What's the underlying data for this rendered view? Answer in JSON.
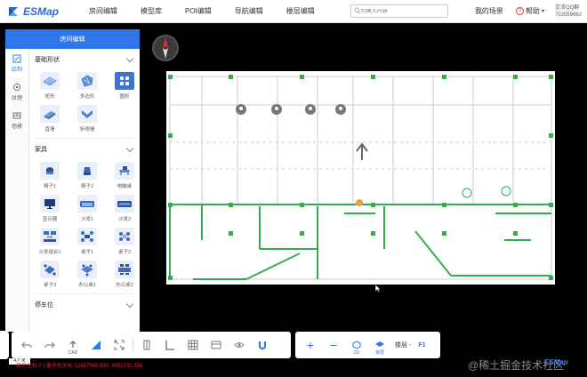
{
  "app": {
    "name": "ESMap",
    "brand_color": "#2b68d8"
  },
  "nav": {
    "items": [
      {
        "label": "房间编辑",
        "active": true
      },
      {
        "label": "模型库"
      },
      {
        "label": "POI编辑"
      },
      {
        "label": "导航编辑"
      },
      {
        "label": "楼层编辑"
      }
    ]
  },
  "search": {
    "placeholder": "切换入内容"
  },
  "topright": {
    "my_scenes": "我的场景",
    "help": "帮助",
    "contact_line1": "交流QQ群",
    "contact_line2": "702059662"
  },
  "panel": {
    "title": "房间编辑",
    "tabs": [
      {
        "label": "绘制",
        "icon": "draw-icon",
        "active": true
      },
      {
        "label": "纹理",
        "icon": "texture-icon"
      },
      {
        "label": "墙模",
        "icon": "wall-icon"
      }
    ],
    "sections": [
      {
        "title": "基础形状",
        "items": [
          {
            "label": "矩形",
            "icon": "rectangle-shape-icon"
          },
          {
            "label": "多边形",
            "icon": "polygon-shape-icon"
          },
          {
            "label": "圆形",
            "icon": "circle-shape-icon"
          },
          {
            "label": "直墙",
            "icon": "straight-wall-icon"
          },
          {
            "label": "折线墙",
            "icon": "polyline-wall-icon"
          }
        ]
      },
      {
        "title": "家具",
        "items": [
          {
            "label": "椅子1",
            "icon": "chair-icon"
          },
          {
            "label": "椅子2",
            "icon": "chair-icon"
          },
          {
            "label": "电脑桌",
            "icon": "computer-desk-icon"
          },
          {
            "label": "显示器",
            "icon": "monitor-icon"
          },
          {
            "label": "沙发1",
            "icon": "sofa-icon"
          },
          {
            "label": "沙发2",
            "icon": "sofa-icon"
          },
          {
            "label": "沙发组合1",
            "icon": "sofa-set-icon"
          },
          {
            "label": "桌子1",
            "icon": "table-icon"
          },
          {
            "label": "桌子2",
            "icon": "table-icon"
          },
          {
            "label": "桌子3",
            "icon": "table-icon"
          },
          {
            "label": "办公桌1",
            "icon": "office-desk-icon"
          },
          {
            "label": "办公桌2",
            "icon": "office-desk-icon"
          }
        ]
      },
      {
        "title": "停车位"
      }
    ]
  },
  "toolbar": {
    "buttons": [
      {
        "name": "undo-button",
        "icon": "undo-icon"
      },
      {
        "name": "redo-button",
        "icon": "redo-icon"
      },
      {
        "name": "cad-import-button",
        "icon": "upload-icon",
        "label": "CAD"
      },
      {
        "name": "draw-triangle-button",
        "icon": "triangle-icon"
      },
      {
        "name": "fullscreen-button",
        "icon": "expand-icon"
      },
      {
        "name": "align-button",
        "icon": "align-icon"
      },
      {
        "name": "angle-button",
        "icon": "angle-icon"
      },
      {
        "name": "grid-button",
        "icon": "grid-icon"
      },
      {
        "name": "layer-button",
        "icon": "layer-icon"
      },
      {
        "name": "visibility-button",
        "icon": "eye-icon"
      },
      {
        "name": "magnet-button",
        "icon": "magnet-icon"
      }
    ]
  },
  "view_toolbar": {
    "zoom_in": "+",
    "zoom_out": "−",
    "mode_2d": "2D",
    "mode_single": "单层",
    "floor_label": "楼层",
    "floor_value": "F1"
  },
  "footer": {
    "scale": "4.7 米",
    "coords": "显示坐标:0 | 墨卡托坐标:12957488.688, 4851031.356",
    "watermark": "@稀土掘金技术社区",
    "brand_mini": "ESMap"
  },
  "colors": {
    "accent": "#2e77ea",
    "wall_green": "#2fae4e",
    "coord_red": "#e02626"
  }
}
